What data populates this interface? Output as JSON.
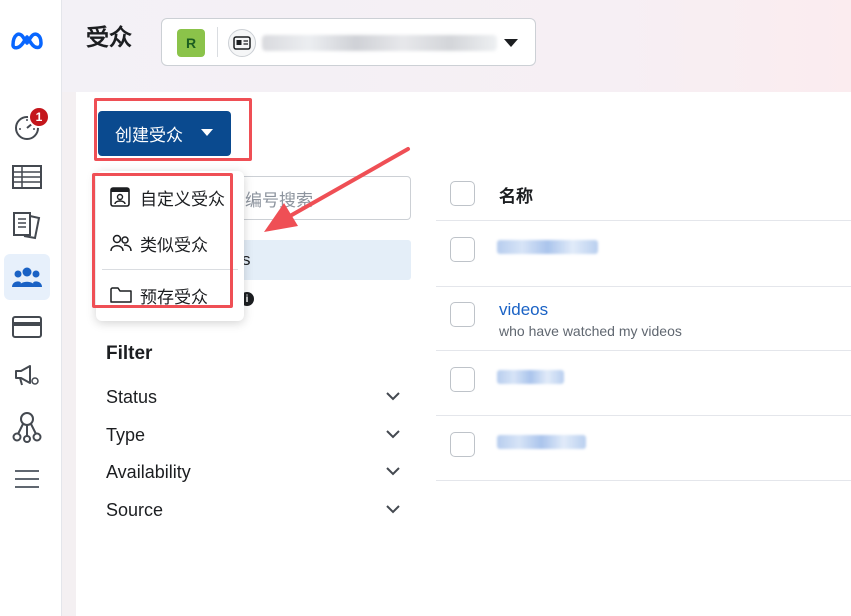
{
  "page": {
    "title": "受众",
    "account_badge": "R"
  },
  "create_button": {
    "label": "创建受众"
  },
  "dropdown": {
    "items": [
      {
        "label": "自定义受众",
        "icon": "custom-audience-icon"
      },
      {
        "label": "类似受众",
        "icon": "lookalike-audience-icon"
      },
      {
        "label": "预存受众",
        "icon": "folder-icon"
      }
    ]
  },
  "search": {
    "placeholder": "编号搜索"
  },
  "sidebar_list": {
    "selected_suffix": "s"
  },
  "filter": {
    "title": "Filter",
    "rows": [
      "Status",
      "Type",
      "Availability",
      "Source"
    ]
  },
  "table": {
    "header_name": "名称",
    "rows": [
      {
        "name": "",
        "subtitle": ""
      },
      {
        "name": "videos",
        "subtitle": "who have watched my videos"
      },
      {
        "name": "",
        "subtitle": ""
      },
      {
        "name": "",
        "subtitle": ""
      }
    ]
  },
  "notifications": {
    "count": "1"
  },
  "colors": {
    "primary_button": "#0a4a8f",
    "annotation_red": "#ef4f55",
    "link": "#1a62c5",
    "badge": "#c4161c",
    "meta_blue": "#0866ff"
  }
}
